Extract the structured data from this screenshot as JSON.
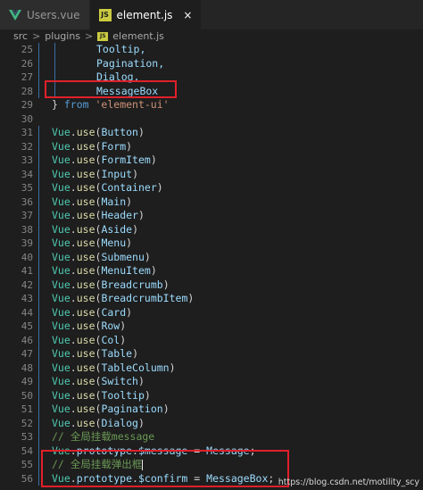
{
  "tabs": [
    {
      "label": "Users.vue",
      "icon": "vue-icon",
      "active": false
    },
    {
      "label": "element.js",
      "icon": "js-icon",
      "active": true
    }
  ],
  "close_glyph": "×",
  "breadcrumb": {
    "parts": [
      "src",
      "plugins",
      "element.js"
    ],
    "separator": ">"
  },
  "lines": [
    {
      "n": "25",
      "text": "Tooltip,"
    },
    {
      "n": "26",
      "text": "Pagination,"
    },
    {
      "n": "27",
      "text": "Dialog,"
    },
    {
      "n": "28",
      "text": "MessageBox"
    },
    {
      "n": "29",
      "text": "} from 'element-ui'"
    },
    {
      "n": "30",
      "text": ""
    },
    {
      "n": "31",
      "text": "Vue.use(Button)"
    },
    {
      "n": "32",
      "text": "Vue.use(Form)"
    },
    {
      "n": "33",
      "text": "Vue.use(FormItem)"
    },
    {
      "n": "34",
      "text": "Vue.use(Input)"
    },
    {
      "n": "35",
      "text": "Vue.use(Container)"
    },
    {
      "n": "36",
      "text": "Vue.use(Main)"
    },
    {
      "n": "37",
      "text": "Vue.use(Header)"
    },
    {
      "n": "38",
      "text": "Vue.use(Aside)"
    },
    {
      "n": "39",
      "text": "Vue.use(Menu)"
    },
    {
      "n": "40",
      "text": "Vue.use(Submenu)"
    },
    {
      "n": "41",
      "text": "Vue.use(MenuItem)"
    },
    {
      "n": "42",
      "text": "Vue.use(Breadcrumb)"
    },
    {
      "n": "43",
      "text": "Vue.use(BreadcrumbItem)"
    },
    {
      "n": "44",
      "text": "Vue.use(Card)"
    },
    {
      "n": "45",
      "text": "Vue.use(Row)"
    },
    {
      "n": "46",
      "text": "Vue.use(Col)"
    },
    {
      "n": "47",
      "text": "Vue.use(Table)"
    },
    {
      "n": "48",
      "text": "Vue.use(TableColumn)"
    },
    {
      "n": "49",
      "text": "Vue.use(Switch)"
    },
    {
      "n": "50",
      "text": "Vue.use(Tooltip)"
    },
    {
      "n": "51",
      "text": "Vue.use(Pagination)"
    },
    {
      "n": "52",
      "text": "Vue.use(Dialog)"
    },
    {
      "n": "53",
      "text": "// 全局挂载message"
    },
    {
      "n": "54",
      "text": "Vue.prototype.$message = Message;"
    },
    {
      "n": "55",
      "text": "// 全局挂载弹出框"
    },
    {
      "n": "56",
      "text": "Vue.prototype.$confirm = MessageBox;"
    }
  ],
  "watermark": "https://blog.csdn.net/motility_scy",
  "colors": {
    "highlight_box": "#e0202a",
    "editor_bg": "#1e1e1e"
  }
}
